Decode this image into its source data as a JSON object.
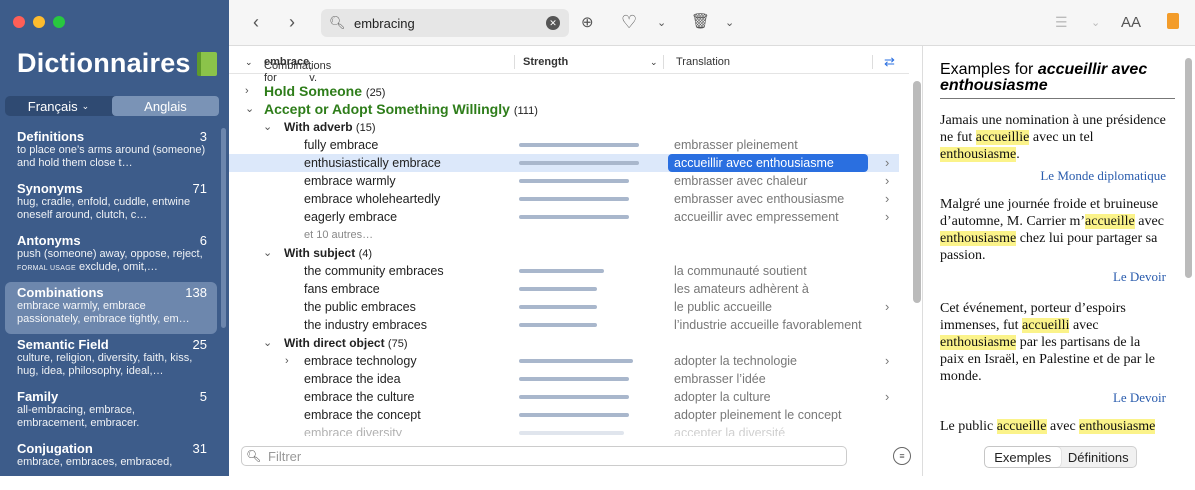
{
  "app": {
    "title": "Dictionnaires",
    "lang_tabs": [
      "Français",
      "Anglais"
    ],
    "lang_selected": "Anglais"
  },
  "sidebar": {
    "items": [
      {
        "name": "Definitions",
        "count": "3",
        "desc": "to place one’s arms around (someone) and hold them close t…"
      },
      {
        "name": "Synonyms",
        "count": "71",
        "desc": "hug, cradle, enfold, cuddle, entwine oneself around, clutch, c…"
      },
      {
        "name": "Antonyms",
        "count": "6",
        "desc_a": "push (someone) away, oppose, reject, ",
        "formal": "FORMAL USAGE",
        "desc_b": " exclude, omit,…"
      },
      {
        "name": "Combinations",
        "count": "138",
        "desc": "embrace warmly, embrace passionately, embrace tightly, em…"
      },
      {
        "name": "Semantic Field",
        "count": "25",
        "desc": "culture, religion, diversity, faith, kiss, hug, idea, philosophy, ideal,…"
      },
      {
        "name": "Family",
        "count": "5",
        "desc": "all-embracing, embrace, embracement, embracer."
      },
      {
        "name": "Conjugation",
        "count": "31",
        "desc": "embrace, embraces, embraced,"
      }
    ]
  },
  "search": {
    "query": "embracing"
  },
  "columns": {
    "combinations_prefix": "Combinations for ",
    "headword": "embrace",
    "pos": ", v.",
    "strength": "Strength",
    "translation": "Translation"
  },
  "rows": [
    {
      "kind": "g1",
      "label": "Hold Someone",
      "count": "(25)",
      "arrow": "›"
    },
    {
      "kind": "g1",
      "label": "Accept or Adopt Something Willingly",
      "count": "(111)",
      "arrow": "⌄"
    },
    {
      "kind": "g2",
      "label": "With adverb",
      "count": "(15)",
      "arrow": "⌄"
    },
    {
      "kind": "item",
      "label": "fully embrace",
      "strength": 0.8,
      "tr": "embrasser pleinement"
    },
    {
      "kind": "item",
      "label": "enthusiastically embrace",
      "strength": 0.8,
      "tr": "accueillir avec enthousiasme",
      "selected": true,
      "chev": true
    },
    {
      "kind": "item",
      "label": "embrace warmly",
      "strength": 0.73,
      "tr": "embrasser avec chaleur",
      "chev": true
    },
    {
      "kind": "item",
      "label": "embrace wholeheartedly",
      "strength": 0.73,
      "tr": "embrasser avec enthousiasme",
      "chev": true
    },
    {
      "kind": "item",
      "label": "eagerly embrace",
      "strength": 0.73,
      "tr": "accueillir avec empressement",
      "chev": true
    },
    {
      "kind": "more",
      "label": "et 10 autres…"
    },
    {
      "kind": "g2",
      "label": "With subject",
      "count": "(4)",
      "arrow": "⌄"
    },
    {
      "kind": "item",
      "label": "the community embraces",
      "strength": 0.57,
      "tr": "la communauté soutient"
    },
    {
      "kind": "item",
      "label": "fans embrace",
      "strength": 0.52,
      "tr": "les amateurs adhèrent à"
    },
    {
      "kind": "item",
      "label": "the public embraces",
      "strength": 0.52,
      "tr": "le public accueille",
      "chev": true
    },
    {
      "kind": "item",
      "label": "the industry embraces",
      "strength": 0.52,
      "tr": "l’industrie accueille favorablement"
    },
    {
      "kind": "g2",
      "label": "With direct object",
      "count": "(75)",
      "arrow": "⌄"
    },
    {
      "kind": "item",
      "label": "embrace technology",
      "strength": 0.76,
      "tr": "adopter la technologie",
      "arrow": "›",
      "chev": true
    },
    {
      "kind": "item",
      "label": "embrace the idea",
      "strength": 0.73,
      "tr": "embrasser l’idée"
    },
    {
      "kind": "item",
      "label": "embrace the culture",
      "strength": 0.73,
      "tr": "adopter la culture",
      "chev": true
    },
    {
      "kind": "item",
      "label": "embrace the concept",
      "strength": 0.73,
      "tr": "adopter pleinement le concept"
    },
    {
      "kind": "item",
      "label": "embrace diversity",
      "strength": 0.7,
      "tr": "accepter la diversité",
      "faded": true
    }
  ],
  "filter": {
    "placeholder": "Filtrer"
  },
  "examples": {
    "title_prefix": "Examples for ",
    "title_phrase": "accueillir avec enthousiasme",
    "items": [
      {
        "parts": [
          "Jamais une nomination à une présidence ne fut ",
          "accueillie",
          " avec un tel ",
          "enthousiasme",
          "."
        ],
        "source": "Le Monde diplomatique"
      },
      {
        "parts": [
          "Malgré une journée froide et bruineuse d’automne, M. Carrier m’",
          "accueille",
          " avec ",
          "enthousiasme",
          " chez lui pour partager sa passion."
        ],
        "source": "Le Devoir"
      },
      {
        "parts": [
          "Cet événement, porteur d’espoirs immenses, fut ",
          "accueilli",
          " avec ",
          "enthousiasme",
          " par les partisans de la paix en Israël, en Palestine et de par le monde."
        ],
        "source": "Le Devoir"
      },
      {
        "parts": [
          "Le public ",
          "accueille",
          " avec ",
          "enthousiasme",
          ""
        ],
        "source": ""
      }
    ],
    "tabs": [
      "Exemples",
      "Définitions"
    ],
    "tab_selected": "Exemples"
  },
  "colors": {
    "sidebar": "#3d5c8a",
    "sidebar_selected": "#6d87ad",
    "group_green": "#2e7d1a",
    "selection_blue": "#2a6fe0",
    "highlight": "#fbf38a"
  }
}
